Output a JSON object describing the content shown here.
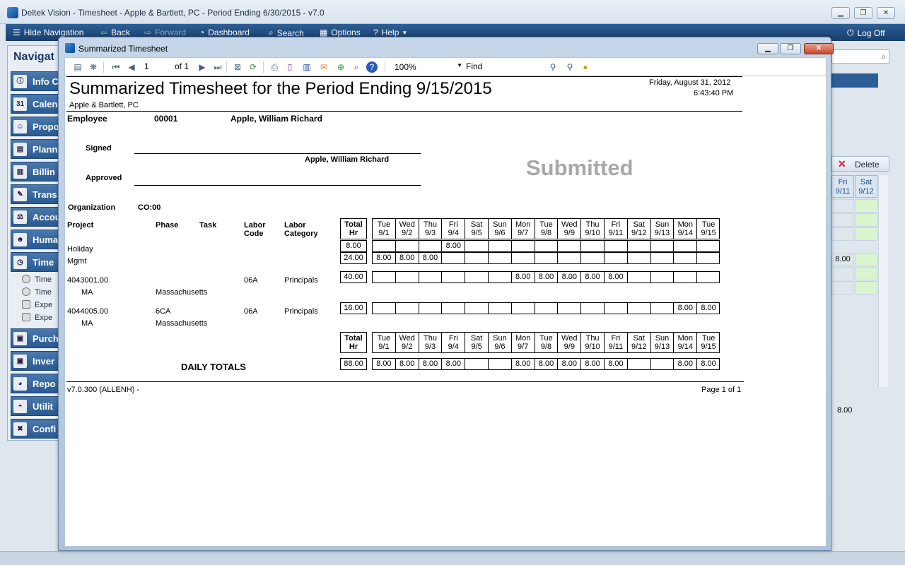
{
  "app": {
    "title": "Deltek Vision - Timesheet - Apple & Bartlett, PC - Period Ending 6/30/2015 - v7.0",
    "nav": [
      "Hide Navigation",
      "Back",
      "Forward",
      "Dashboard",
      "Search",
      "Options",
      "Help"
    ],
    "logoff": "Log Off"
  },
  "navpanel": {
    "header": "Navigat",
    "items": [
      "Info C",
      "Calen",
      "Propo",
      "Plann",
      "Billin",
      "Trans",
      "Accou",
      "Huma",
      "Time",
      "Purch",
      "Inver",
      "Repo",
      "Utilit",
      "Confi"
    ],
    "calendar_num": "31",
    "sub": [
      "Time",
      "Time",
      "Expe",
      "Expe"
    ]
  },
  "background_grid": {
    "delete_label": "Delete",
    "headers": [
      [
        "Fri",
        "9/11"
      ],
      [
        "Sat",
        "9/12"
      ]
    ],
    "row_value": "8.00",
    "total": "8.00"
  },
  "dialog": {
    "title": "Summarized Timesheet",
    "toolbar": {
      "page": "1",
      "of": "of 1",
      "zoom": "100%",
      "find": "Find"
    }
  },
  "report": {
    "title": "Summarized Timesheet for the Period Ending 9/15/2015",
    "company": "Apple & Bartlett, PC",
    "date": "Friday, August 31, 2012",
    "time": "6:43:40 PM",
    "employee_label": "Employee",
    "employee_id": "00001",
    "employee_name": "Apple, William Richard",
    "signed_label": "Signed",
    "signed_name": "Apple, William Richard",
    "approved_label": "Approved",
    "status": "Submitted",
    "org_label": "Organization",
    "org_value": "CO:00",
    "columns": {
      "project": "Project",
      "phase": "Phase",
      "task": "Task",
      "labor_code": [
        "Labor",
        "Code"
      ],
      "labor_category": [
        "Labor",
        "Category"
      ],
      "total": [
        "Total",
        "Hr"
      ]
    },
    "days": [
      [
        "Tue",
        "9/1"
      ],
      [
        "Wed",
        "9/2"
      ],
      [
        "Thu",
        "9/3"
      ],
      [
        "Fri",
        "9/4"
      ],
      [
        "Sat",
        "9/5"
      ],
      [
        "Sun",
        "9/6"
      ],
      [
        "Mon",
        "9/7"
      ],
      [
        "Tue",
        "9/8"
      ],
      [
        "Wed",
        "9/9"
      ],
      [
        "Thu",
        "9/10"
      ],
      [
        "Fri",
        "9/11"
      ],
      [
        "Sat",
        "9/12"
      ],
      [
        "Sun",
        "9/13"
      ],
      [
        "Mon",
        "9/14"
      ],
      [
        "Tue",
        "9/15"
      ]
    ],
    "rows": [
      {
        "project": "Holiday",
        "total": "8.00",
        "hours": [
          "",
          "",
          "",
          "8.00",
          "",
          "",
          "",
          "",
          "",
          "",
          "",
          "",
          "",
          "",
          ""
        ]
      },
      {
        "project": "Mgmt",
        "total": "24.00",
        "hours": [
          "8.00",
          "8.00",
          "8.00",
          "",
          "",
          "",
          "",
          "",
          "",
          "",
          "",
          "",
          "",
          "",
          ""
        ]
      },
      {
        "project": "4043001.00",
        "sub": "MA",
        "phase": "Massachusetts",
        "labor_code": "06A",
        "labor_category": "Principals",
        "total": "40.00",
        "hours": [
          "",
          "",
          "",
          "",
          "",
          "",
          "8.00",
          "8.00",
          "8.00",
          "8.00",
          "8.00",
          "",
          "",
          "",
          ""
        ]
      },
      {
        "project": "4044005.00",
        "sub": "MA",
        "phase_code": "6CA",
        "phase": "Massachusetts",
        "labor_code": "06A",
        "labor_category": "Principals",
        "total": "16.00",
        "hours": [
          "",
          "",
          "",
          "",
          "",
          "",
          "",
          "",
          "",
          "",
          "",
          "",
          "",
          "8.00",
          "8.00"
        ]
      }
    ],
    "daily_totals_label": "DAILY TOTALS",
    "daily_totals": {
      "total": "88.00",
      "hours": [
        "8.00",
        "8.00",
        "8.00",
        "8.00",
        "",
        "",
        "8.00",
        "8.00",
        "8.00",
        "8.00",
        "8.00",
        "",
        "",
        "8.00",
        "8.00"
      ]
    },
    "footer_left": "v7.0.300 (ALLENH) -",
    "footer_right": "Page 1 of 1"
  }
}
